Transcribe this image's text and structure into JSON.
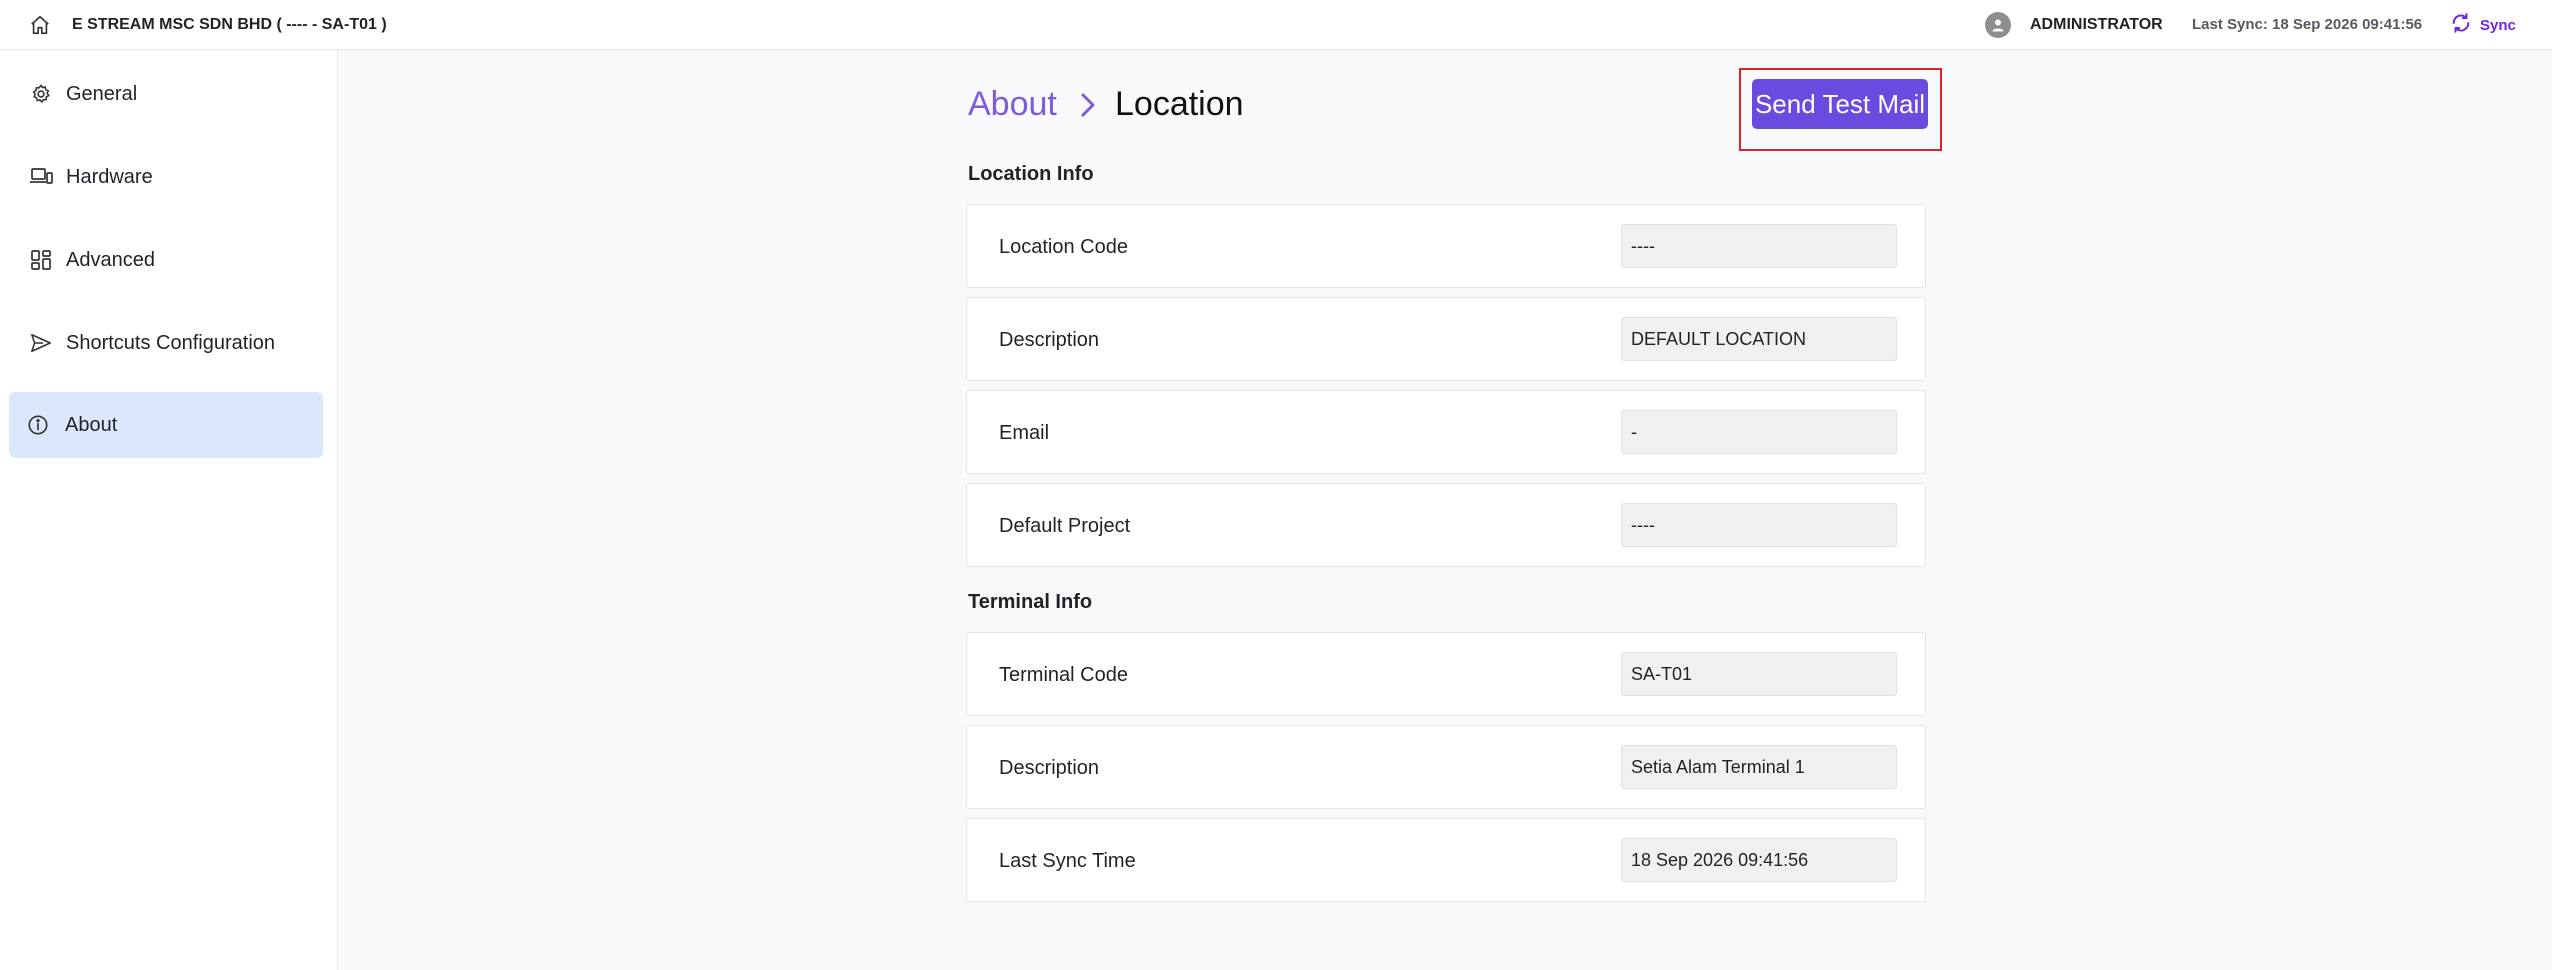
{
  "topbar": {
    "home_icon": "home-icon",
    "company": "E STREAM MSC SDN BHD ( ---- - SA-T01 )",
    "user_icon": "user-icon",
    "username": "ADMINISTRATOR",
    "last_sync": "Last Sync: 18 Sep 2026 09:41:56",
    "sync_icon": "refresh-icon",
    "sync_label": "Sync"
  },
  "sidebar": {
    "items": [
      {
        "label": "General",
        "icon": "gear-icon",
        "active": false
      },
      {
        "label": "Hardware",
        "icon": "devices-icon",
        "active": false
      },
      {
        "label": "Advanced",
        "icon": "grid-icon",
        "active": false
      },
      {
        "label": "Shortcuts Configuration",
        "icon": "send-icon",
        "active": false
      },
      {
        "label": "About",
        "icon": "info-icon",
        "active": true
      }
    ]
  },
  "breadcrumb": {
    "parent": "About",
    "current": "Location"
  },
  "actions": {
    "send_test_mail": "Send Test Mail"
  },
  "location_info": {
    "title": "Location Info",
    "rows": [
      {
        "label": "Location Code",
        "value": "----"
      },
      {
        "label": "Description",
        "value": "DEFAULT LOCATION"
      },
      {
        "label": "Email",
        "value": "-"
      },
      {
        "label": "Default Project",
        "value": "----"
      }
    ]
  },
  "terminal_info": {
    "title": "Terminal Info",
    "rows": [
      {
        "label": "Terminal Code",
        "value": "SA-T01"
      },
      {
        "label": "Description",
        "value": "Setia Alam Terminal 1"
      },
      {
        "label": "Last Sync Time",
        "value": "18 Sep 2026 09:41:56"
      }
    ]
  },
  "colors": {
    "accent": "#6a4be0",
    "breadcrumb_link": "#7c5cdb",
    "sync": "#6d28d9",
    "active_nav": "#dbe8fc",
    "highlight": "#e0202a"
  }
}
